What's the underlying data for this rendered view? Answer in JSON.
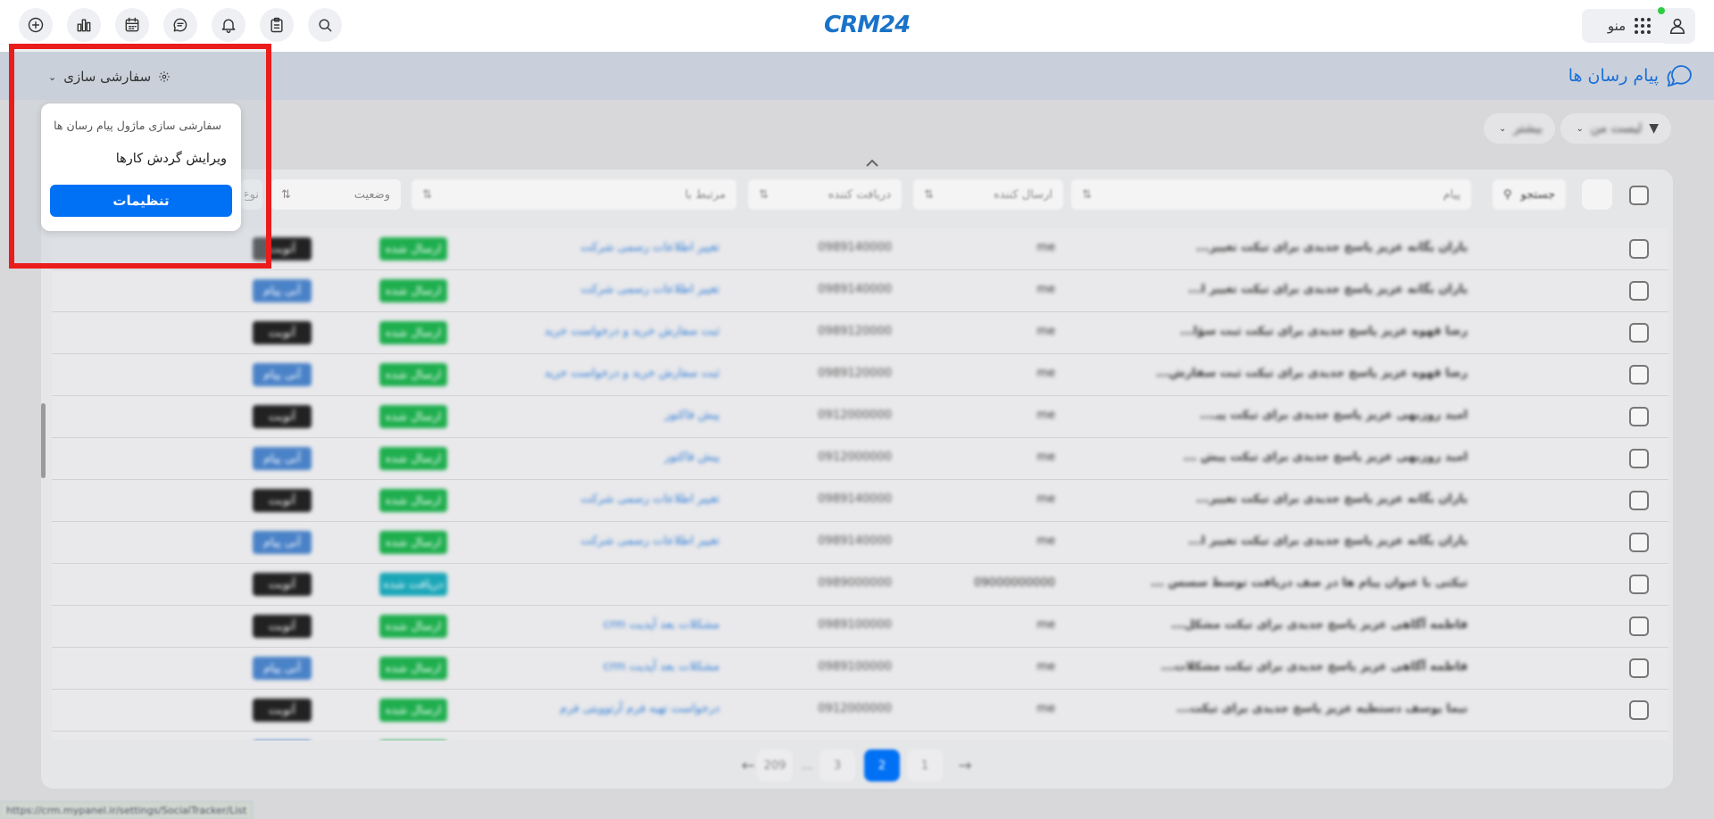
{
  "topbar": {
    "logo": "CRM24",
    "menu_label": "منو",
    "icons": [
      "add-icon",
      "chart-icon",
      "calendar-icon",
      "chat-icon",
      "bell-icon",
      "clipboard-icon",
      "search-icon"
    ]
  },
  "header": {
    "title": "پیام رسان ها",
    "customize_label": "سفارشی سازی"
  },
  "customize_dropdown": {
    "title": "سفارشی سازی ماژول پیام رسان ها",
    "item": "ویرایش گردش کارها",
    "button": "تنظیمات"
  },
  "filters": {
    "my_list": "لیست من",
    "more": "بیشتر"
  },
  "table": {
    "search_label": "جستجو",
    "columns": {
      "message": "پیام",
      "sender": "ارسال کننده",
      "receiver": "دریافت کننده",
      "related": "مرتبط با",
      "status": "وضعیت",
      "type": "نوع"
    },
    "rows": [
      {
        "message": "یاران یگانه عزیز پاسخ جدیدی برای تیکت تغییر...",
        "sender": "me",
        "receiver": "0989140000",
        "related": "تغییر اطلاعات رسمی شرکت",
        "status": "ارسال شده",
        "status_color": "#1eae4e",
        "type": "آتوبت",
        "type_color": "#222222"
      },
      {
        "message": "یاران یگانه عزیز پاسخ جدیدی برای تیکت تغییر ا...",
        "sender": "me",
        "receiver": "0989140000",
        "related": "تغییر اطلاعات رسمی شرکت",
        "status": "ارسال شده",
        "status_color": "#1eae4e",
        "type": "آنی پیام",
        "type_color": "#4a82c8"
      },
      {
        "message": "رضا قهوه عزیز پاسخ جدیدی برای تیکت ثبت سؤا...",
        "sender": "me",
        "receiver": "0989120000",
        "related": "ثبت سفارش خرید و درخواست خرید",
        "status": "ارسال شده",
        "status_color": "#1eae4e",
        "type": "آتوبت",
        "type_color": "#222222"
      },
      {
        "message": "رضا قهوه عزیز پاسخ جدیدی برای تیکت ثبت سفارش...",
        "sender": "me",
        "receiver": "0989120000",
        "related": "ثبت سفارش خرید و درخواست خرید",
        "status": "ارسال شده",
        "status_color": "#1eae4e",
        "type": "آنی پیام",
        "type_color": "#4a82c8"
      },
      {
        "message": "امید روزبهی عزیز پاسخ جدیدی برای تیکت پیـ...",
        "sender": "me",
        "receiver": "0912000000",
        "related": "پیش فاکتور",
        "status": "ارسال شده",
        "status_color": "#1eae4e",
        "type": "آتوبت",
        "type_color": "#222222"
      },
      {
        "message": "امید روزبهی عزیز پاسخ جدیدی برای تیکت پیش ...",
        "sender": "me",
        "receiver": "0912000000",
        "related": "پیش فاکتور",
        "status": "ارسال شده",
        "status_color": "#1eae4e",
        "type": "آنی پیام",
        "type_color": "#4a82c8"
      },
      {
        "message": "یاران یگانه عزیز پاسخ جدیدی برای تیکت تغییر...",
        "sender": "me",
        "receiver": "0989140000",
        "related": "تغییر اطلاعات رسمی شرکت",
        "status": "ارسال شده",
        "status_color": "#1eae4e",
        "type": "آتوبت",
        "type_color": "#222222"
      },
      {
        "message": "یاران یگانه عزیز پاسخ جدیدی برای تیکت تغییر ا...",
        "sender": "me",
        "receiver": "0989140000",
        "related": "تغییر اطلاعات رسمی شرکت",
        "status": "ارسال شده",
        "status_color": "#1eae4e",
        "type": "آنی پیام",
        "type_color": "#4a82c8"
      },
      {
        "message": "تیکتی با عنوان پیام ها در صف دریافت توسط سسس ...",
        "sender": "09000000000",
        "receiver": "0989000000",
        "related": "",
        "status": "دریافت شده",
        "status_color": "#1aa6b7",
        "type": "آتوبت",
        "type_color": "#222222"
      },
      {
        "message": "فاطمه آگاهی عزیز پاسخ جدیدی برای تیکت مشکل...",
        "sender": "me",
        "receiver": "0989100000",
        "related": "مشکلات بعد آپدیت crm",
        "status": "ارسال شده",
        "status_color": "#1eae4e",
        "type": "آتوبت",
        "type_color": "#222222"
      },
      {
        "message": "فاطمه آگاهی عزیز پاسخ جدیدی برای تیکت مشکلات...",
        "sender": "me",
        "receiver": "0989100000",
        "related": "مشکلات بعد آپدیت crm",
        "status": "ارسال شده",
        "status_color": "#1eae4e",
        "type": "آنی پیام",
        "type_color": "#4a82c8"
      },
      {
        "message": "نیما یوسف دستطیه عزیز پاسخ جدیدی برای تیکت...",
        "sender": "me",
        "receiver": "0912000000",
        "related": "درخواست تهیه فرم آرتوویتی فرم",
        "status": "ارسال شده",
        "status_color": "#1eae4e",
        "type": "آتوبت",
        "type_color": "#222222"
      },
      {
        "message": "",
        "sender": "",
        "receiver": "",
        "related": "",
        "status": "ارسال شده",
        "status_color": "#1eae4e",
        "type": "آنی پیام",
        "type_color": "#4a82c8"
      }
    ]
  },
  "pagination": {
    "pages": [
      "1",
      "2",
      "3",
      "...",
      "209"
    ],
    "active": "2"
  },
  "status_url": "https://crm.mypanel.ir/settings/SocialTracker/List"
}
